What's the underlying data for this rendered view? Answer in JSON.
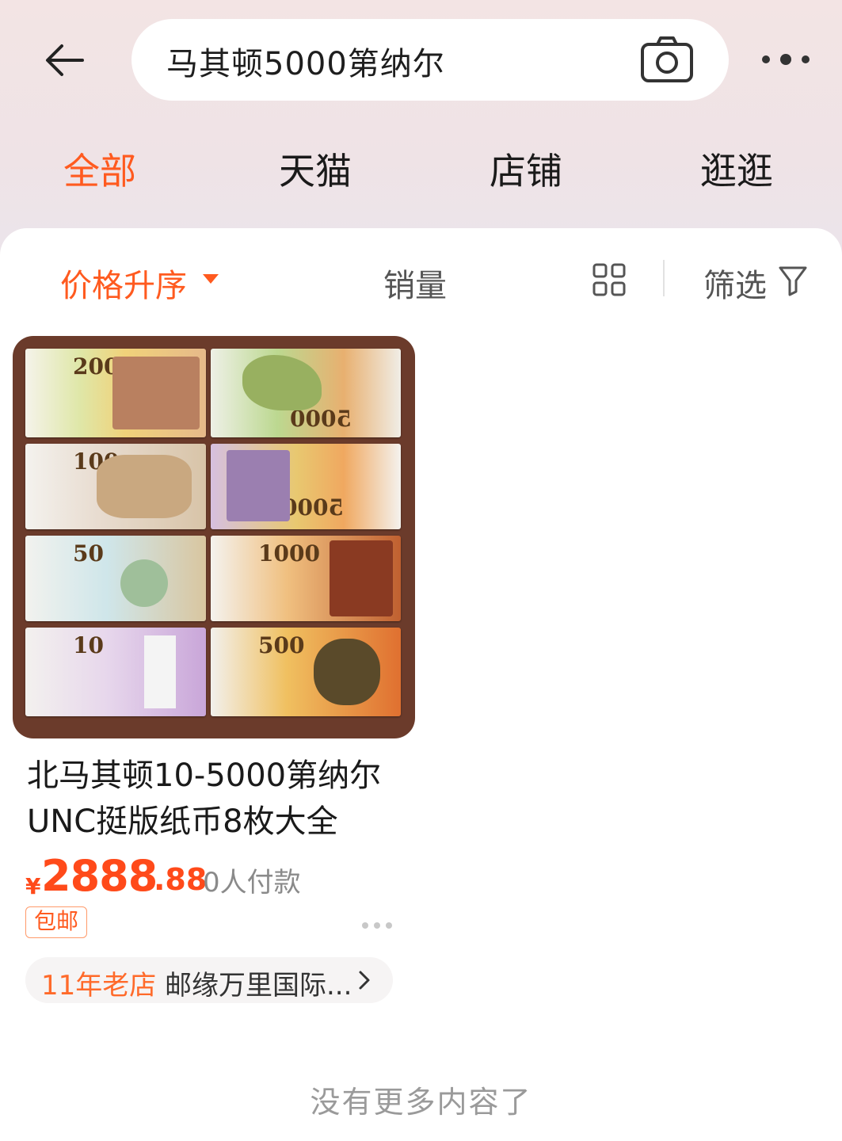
{
  "header": {
    "search_value": "马其顿5000第纳尔"
  },
  "tabs": [
    {
      "label": "全部",
      "active": true
    },
    {
      "label": "天猫",
      "active": false
    },
    {
      "label": "店铺",
      "active": false
    },
    {
      "label": "逛逛",
      "active": false
    }
  ],
  "sortbar": {
    "price_label": "价格升序",
    "sales_label": "销量",
    "filter_label": "筛选"
  },
  "product": {
    "title": "北马其顿10-5000第纳尔UNC挺版纸币8枚大全",
    "currency": "¥",
    "price_int": "2888",
    "price_dec": ".88",
    "buyers": "0人付款",
    "tag": "包邮",
    "shop_age": "11年老店",
    "shop_name": "邮缘万里国际...",
    "notes": [
      "200",
      "5000",
      "100",
      "5000",
      "50",
      "1000",
      "10",
      "500"
    ]
  },
  "footer": {
    "end_text": "没有更多内容了"
  },
  "colors": {
    "accent": "#ff5a1f",
    "price": "#ff4a1a"
  }
}
